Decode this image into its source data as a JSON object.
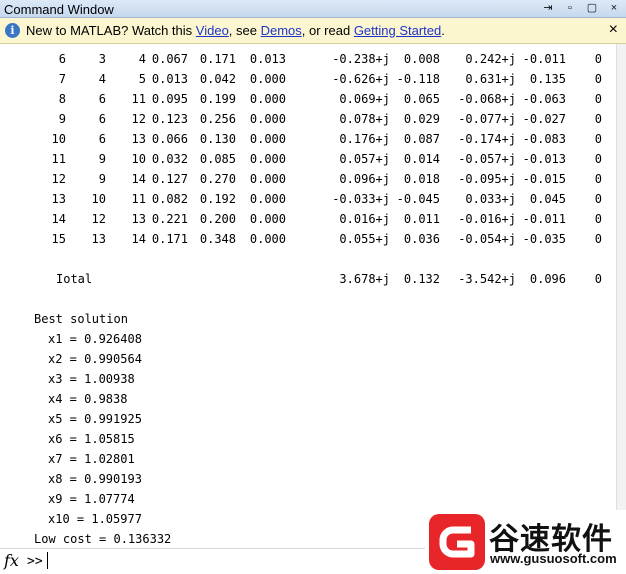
{
  "window": {
    "title": "Command Window",
    "btns": [
      "⇥",
      "▫",
      "▢",
      "×"
    ]
  },
  "infobar": {
    "icon": "i",
    "pre": "New to MATLAB? Watch this ",
    "video": "Video",
    "sep1": ", see ",
    "demos": "Demos",
    "sep2": ", or read ",
    "gs": "Getting Started",
    "end": ".",
    "close": "×"
  },
  "table": {
    "rows": [
      [
        "6",
        "3",
        "4",
        "0.067",
        "0.171",
        "0.013",
        "-0.238+j",
        "0.008",
        "0.242+j",
        "-0.011",
        "0"
      ],
      [
        "7",
        "4",
        "5",
        "0.013",
        "0.042",
        "0.000",
        "-0.626+j",
        "-0.118",
        "0.631+j",
        "0.135",
        "0"
      ],
      [
        "8",
        "6",
        "11",
        "0.095",
        "0.199",
        "0.000",
        "0.069+j",
        "0.065",
        "-0.068+j",
        "-0.063",
        "0"
      ],
      [
        "9",
        "6",
        "12",
        "0.123",
        "0.256",
        "0.000",
        "0.078+j",
        "0.029",
        "-0.077+j",
        "-0.027",
        "0"
      ],
      [
        "10",
        "6",
        "13",
        "0.066",
        "0.130",
        "0.000",
        "0.176+j",
        "0.087",
        "-0.174+j",
        "-0.083",
        "0"
      ],
      [
        "11",
        "9",
        "10",
        "0.032",
        "0.085",
        "0.000",
        "0.057+j",
        "0.014",
        "-0.057+j",
        "-0.013",
        "0"
      ],
      [
        "12",
        "9",
        "14",
        "0.127",
        "0.270",
        "0.000",
        "0.096+j",
        "0.018",
        "-0.095+j",
        "-0.015",
        "0"
      ],
      [
        "13",
        "10",
        "11",
        "0.082",
        "0.192",
        "0.000",
        "-0.033+j",
        "-0.045",
        "0.033+j",
        "0.045",
        "0"
      ],
      [
        "14",
        "12",
        "13",
        "0.221",
        "0.200",
        "0.000",
        "0.016+j",
        "0.011",
        "-0.016+j",
        "-0.011",
        "0"
      ],
      [
        "15",
        "13",
        "14",
        "0.171",
        "0.348",
        "0.000",
        "0.055+j",
        "0.036",
        "-0.054+j",
        "-0.035",
        "0"
      ]
    ],
    "total": {
      "label": "Iotal",
      "a": "3.678+j",
      "b": "0.132",
      "c": "-3.542+j",
      "d": "0.096",
      "e": "0"
    }
  },
  "best": {
    "heading": "Best solution",
    "lines": [
      "x1 = 0.926408",
      "x2 = 0.990564",
      "x3 = 1.00938",
      "x4 = 0.9838",
      "x5 = 0.991925",
      "x6 = 1.05815",
      "x7 = 1.02801",
      "x8 = 0.990193",
      "x9 = 1.07774",
      "x10 = 1.05977"
    ],
    "cost": "Low cost = 0.136332"
  },
  "prompt": {
    "fx": "fx",
    "chev": ">>"
  },
  "brand": {
    "cn": "谷速软件",
    "url": "www.gusuosoft.com",
    "logo_color": "#e8262a"
  }
}
